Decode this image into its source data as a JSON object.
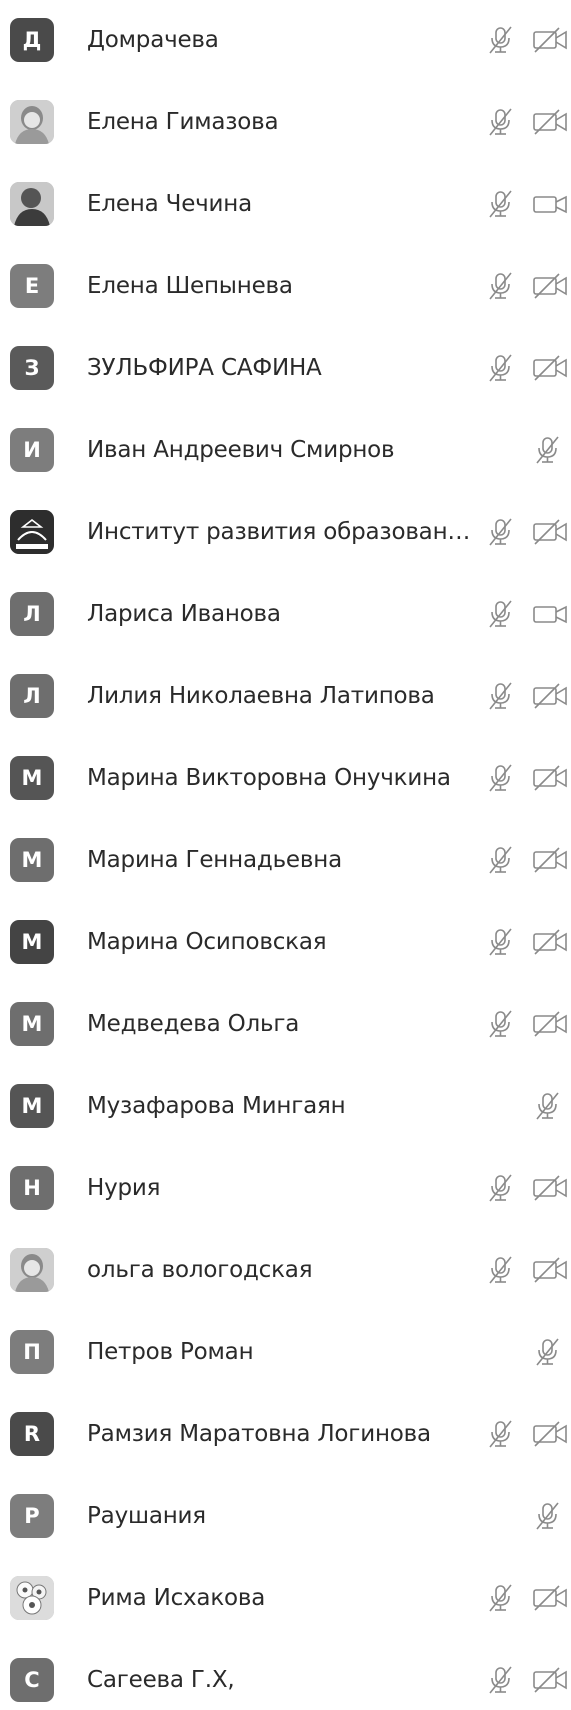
{
  "colors": {
    "avatar_dark": "#4a4a4a",
    "avatar_mid": "#6e6e6e",
    "avatar_light": "#7d7d7d",
    "icon": "#8a8a8a",
    "text": "#2a2a2a"
  },
  "participants": [
    {
      "name": "Домрачева",
      "avatar": {
        "type": "letter",
        "letter": "Д",
        "color": "#4a4a4a"
      },
      "mic": "muted",
      "camera": "off"
    },
    {
      "name": "Елена Гимазова",
      "avatar": {
        "type": "photo",
        "icon": "woman-portrait"
      },
      "mic": "muted",
      "camera": "off"
    },
    {
      "name": "Елена Чечина",
      "avatar": {
        "type": "photo",
        "icon": "person-portrait"
      },
      "mic": "muted",
      "camera": "on"
    },
    {
      "name": "Елена Шепынева",
      "avatar": {
        "type": "letter",
        "letter": "Е",
        "color": "#7d7d7d"
      },
      "mic": "muted",
      "camera": "off"
    },
    {
      "name": "ЗУЛЬФИРА САФИНА",
      "avatar": {
        "type": "letter",
        "letter": "З",
        "color": "#5a5a5a"
      },
      "mic": "muted",
      "camera": "off"
    },
    {
      "name": "Иван Андреевич Смирнов",
      "avatar": {
        "type": "letter",
        "letter": "И",
        "color": "#7d7d7d"
      },
      "mic": "muted",
      "camera": "none"
    },
    {
      "name": "Институт развития образовани...",
      "avatar": {
        "type": "photo",
        "icon": "institute-logo"
      },
      "mic": "muted",
      "camera": "off"
    },
    {
      "name": "Лариса Иванова",
      "avatar": {
        "type": "letter",
        "letter": "Л",
        "color": "#6e6e6e"
      },
      "mic": "muted",
      "camera": "on"
    },
    {
      "name": "Лилия Николаевна Латипова",
      "avatar": {
        "type": "letter",
        "letter": "Л",
        "color": "#6e6e6e"
      },
      "mic": "muted",
      "camera": "off"
    },
    {
      "name": "Марина Викторовна Онучкина",
      "avatar": {
        "type": "letter",
        "letter": "М",
        "color": "#555555"
      },
      "mic": "muted",
      "camera": "off"
    },
    {
      "name": "Марина Геннадьевна",
      "avatar": {
        "type": "letter",
        "letter": "М",
        "color": "#6e6e6e"
      },
      "mic": "muted",
      "camera": "off"
    },
    {
      "name": "Марина Осиповская",
      "avatar": {
        "type": "letter",
        "letter": "М",
        "color": "#444444"
      },
      "mic": "muted",
      "camera": "off"
    },
    {
      "name": "Медведева Ольга",
      "avatar": {
        "type": "letter",
        "letter": "М",
        "color": "#6e6e6e"
      },
      "mic": "muted",
      "camera": "off"
    },
    {
      "name": "Музафарова Мингаян",
      "avatar": {
        "type": "letter",
        "letter": "М",
        "color": "#555555"
      },
      "mic": "muted",
      "camera": "none"
    },
    {
      "name": "Нурия",
      "avatar": {
        "type": "letter",
        "letter": "Н",
        "color": "#6e6e6e"
      },
      "mic": "muted",
      "camera": "off"
    },
    {
      "name": "ольга вологодская",
      "avatar": {
        "type": "photo",
        "icon": "woman-portrait"
      },
      "mic": "muted",
      "camera": "off"
    },
    {
      "name": "Петров Роман",
      "avatar": {
        "type": "letter",
        "letter": "П",
        "color": "#7d7d7d"
      },
      "mic": "muted",
      "camera": "none"
    },
    {
      "name": "Рамзия Маратовна Логинова",
      "avatar": {
        "type": "letter",
        "letter": "R",
        "color": "#4a4a4a"
      },
      "mic": "muted",
      "camera": "off"
    },
    {
      "name": "Раушания",
      "avatar": {
        "type": "letter",
        "letter": "Р",
        "color": "#7d7d7d"
      },
      "mic": "muted",
      "camera": "none"
    },
    {
      "name": "Рима Исхакова",
      "avatar": {
        "type": "photo",
        "icon": "flower-portrait"
      },
      "mic": "muted",
      "camera": "off"
    },
    {
      "name": "Сагеева Г.Х,",
      "avatar": {
        "type": "letter",
        "letter": "С",
        "color": "#6e6e6e"
      },
      "mic": "muted",
      "camera": "off"
    }
  ]
}
